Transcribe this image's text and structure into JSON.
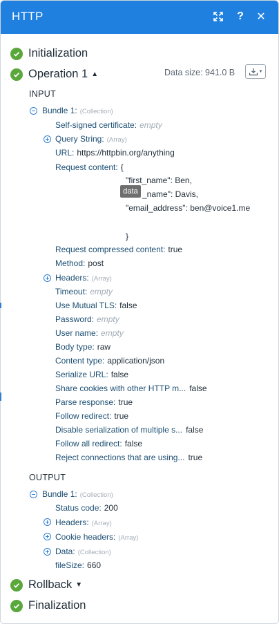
{
  "header": {
    "title": "HTTP"
  },
  "sections": {
    "initialization": "Initialization",
    "operation": "Operation 1",
    "rollback": "Rollback",
    "finalization": "Finalization"
  },
  "data_size": "Data size: 941.0 B",
  "input": {
    "caption": "INPUT",
    "bundle_label": "Bundle 1:",
    "bundle_type": "(Collection)",
    "rows": [
      {
        "key": "Self-signed certificate:",
        "empty": "empty"
      },
      {
        "key": "Query String:",
        "type": "(Array)"
      },
      {
        "key": "URL:",
        "value": "https://httpbin.org/anything"
      },
      {
        "key": "Request content:",
        "value": "{"
      },
      {
        "key": "Request compressed content:",
        "value": "true"
      },
      {
        "key": "Method:",
        "value": "post"
      },
      {
        "key": "Headers:",
        "type": "(Array)"
      },
      {
        "key": "Timeout:",
        "empty": "empty"
      },
      {
        "key": "Use Mutual TLS:",
        "value": "false"
      },
      {
        "key": "Password:",
        "empty": "empty"
      },
      {
        "key": "User name:",
        "empty": "empty"
      },
      {
        "key": "Body type:",
        "value": "raw"
      },
      {
        "key": "Content type:",
        "value": "application/json"
      },
      {
        "key": "Serialize URL:",
        "value": "false"
      },
      {
        "key": "Share cookies with other HTTP m...",
        "value": "false"
      },
      {
        "key": "Parse response:",
        "value": "true"
      },
      {
        "key": "Follow redirect:",
        "value": "true"
      },
      {
        "key": "Disable serialization of multiple s...",
        "value": "false"
      },
      {
        "key": "Follow all redirect:",
        "value": "false"
      },
      {
        "key": "Reject connections that are using...",
        "value": "true"
      }
    ],
    "json_lines": [
      "\"first_name\": Ben,",
      "_name\": Davis,",
      "\"email_address\": ben@voice1.me",
      "}"
    ],
    "tooltip": "data"
  },
  "output": {
    "caption": "OUTPUT",
    "bundle_label": "Bundle 1:",
    "bundle_type": "(Collection)",
    "rows": [
      {
        "key": "Status code:",
        "value": "200"
      },
      {
        "key": "Headers:",
        "type": "(Array)"
      },
      {
        "key": "Cookie headers:",
        "type": "(Array)"
      },
      {
        "key": "Data:",
        "type": "(Collection)"
      },
      {
        "key": "fileSize:",
        "value": "660"
      }
    ]
  },
  "icons": {
    "expand": "expand-icon",
    "help": "help-icon",
    "close": "close-icon",
    "check": "check-circle-icon",
    "download": "download-icon"
  },
  "colors": {
    "header": "#1f80e0",
    "success": "#5aa73c",
    "key": "#1d4f73",
    "toggle": "#2f7fd2"
  }
}
